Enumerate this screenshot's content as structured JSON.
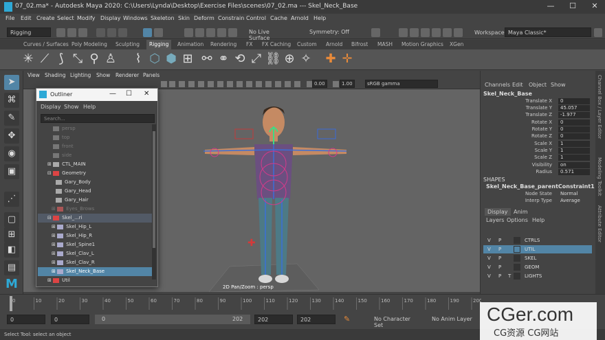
{
  "window": {
    "file_tab": "07_02.ma*",
    "title": "Autodesk Maya 2020: C:\\Users\\Lynda\\Desktop\\Exercise Files\\scenes\\07_02.ma  ---  Skel_Neck_Base",
    "minimize": "—",
    "maximize": "☐",
    "close": "✕"
  },
  "menubar": [
    "File",
    "Edit",
    "Create",
    "Select",
    "Modify",
    "Display",
    "Windows",
    "Skeleton",
    "Skin",
    "Deform",
    "Constrain",
    "Control",
    "Cache",
    "Arnold",
    "Help"
  ],
  "statusline": {
    "menuset": "Rigging",
    "live_surface": "No Live Surface",
    "symmetry": "Symmetry: Off",
    "workspace_label": "Workspace :",
    "workspace": "Maya Classic*"
  },
  "shelf_tabs": [
    "Curves / Surfaces",
    "Poly Modeling",
    "Sculpting",
    "Rigging",
    "Animation",
    "Rendering",
    "FX",
    "FX Caching",
    "Custom",
    "Arnold",
    "Bifrost",
    "MASH",
    "Motion Graphics",
    "XGen"
  ],
  "shelf_active": "Rigging",
  "viewport": {
    "menus": [
      "View",
      "Shading",
      "Lighting",
      "Show",
      "Renderer",
      "Panels"
    ],
    "exposure": "0.00",
    "gamma": "1.00",
    "colorspace": "sRGB gamma",
    "hud": "2D Pan/Zoom : persp"
  },
  "outliner": {
    "title": "Outliner",
    "menus": [
      "Display",
      "Show",
      "Help"
    ],
    "search_placeholder": "Search...",
    "rows": [
      {
        "label": "persp",
        "indent": 1,
        "dim": true
      },
      {
        "label": "top",
        "indent": 1,
        "dim": true
      },
      {
        "label": "front",
        "indent": 1,
        "dim": true
      },
      {
        "label": "side",
        "indent": 1,
        "dim": true
      },
      {
        "label": "CTL_MAIN",
        "indent": 1,
        "dim": false
      },
      {
        "label": "Geometry",
        "indent": 1,
        "dim": false
      },
      {
        "label": "Gary_Body",
        "indent": 2,
        "dim": false
      },
      {
        "label": "Gary_Head",
        "indent": 2,
        "dim": false
      },
      {
        "label": "Gary_Hair",
        "indent": 2,
        "dim": false
      },
      {
        "label": "Eyes_Brows",
        "indent": 2,
        "dim": true
      },
      {
        "label": "Skel_...ri",
        "indent": 1,
        "dim": false
      },
      {
        "label": "Skel_Hip_L",
        "indent": 2,
        "dim": false
      },
      {
        "label": "Skel_Hip_R",
        "indent": 2,
        "dim": false
      },
      {
        "label": "Skel_Spine1",
        "indent": 2,
        "dim": false
      },
      {
        "label": "Skel_Clav_L",
        "indent": 2,
        "dim": false
      },
      {
        "label": "Skel_Clav_R",
        "indent": 2,
        "dim": false
      },
      {
        "label": "Skel_Neck_Base",
        "indent": 2,
        "dim": false
      },
      {
        "label": "Util",
        "indent": 1,
        "dim": false
      }
    ]
  },
  "channelbox": {
    "menus": [
      "Channels",
      "Edit",
      "Object",
      "Show"
    ],
    "node": "Skel_Neck_Base",
    "channels": [
      {
        "name": "Translate X",
        "value": "0"
      },
      {
        "name": "Translate Y",
        "value": "45.057"
      },
      {
        "name": "Translate Z",
        "value": "-1.977"
      },
      {
        "name": "Rotate X",
        "value": "0"
      },
      {
        "name": "Rotate Y",
        "value": "0"
      },
      {
        "name": "Rotate Z",
        "value": "0"
      },
      {
        "name": "Scale X",
        "value": "1"
      },
      {
        "name": "Scale Y",
        "value": "1"
      },
      {
        "name": "Scale Z",
        "value": "1"
      },
      {
        "name": "Visibility",
        "value": "on"
      },
      {
        "name": "Radius",
        "value": "0.571"
      }
    ],
    "shapes_header": "SHAPES",
    "shape_node": "Skel_Neck_Base_parentConstraint1",
    "shape_attrs": [
      {
        "name": "Node State",
        "value": "Normal"
      },
      {
        "name": "Interp Type",
        "value": "Average"
      }
    ]
  },
  "layers": {
    "tabs": [
      "Display",
      "Anim"
    ],
    "menus": [
      "Layers",
      "Options",
      "Help"
    ],
    "rows": [
      {
        "v": "V",
        "p": "P",
        "t": "",
        "name": "CTRLS",
        "color": "#333",
        "sel": false
      },
      {
        "v": "V",
        "p": "P",
        "t": "",
        "name": "UTIL",
        "color": "#5285a6",
        "sel": true
      },
      {
        "v": "V",
        "p": "P",
        "t": "",
        "name": "SKEL",
        "color": "#333",
        "sel": false
      },
      {
        "v": "V",
        "p": "P",
        "t": "",
        "name": "GEOM",
        "color": "#333",
        "sel": false
      },
      {
        "v": "V",
        "p": "P",
        "t": "T",
        "name": "LIGHTS",
        "color": "#333",
        "sel": false
      }
    ]
  },
  "sidetabs": [
    "Channel Box / Layer Editor",
    "Modeling Toolkit",
    "Attribute Editor"
  ],
  "timeslider": {
    "ticks": [
      "0",
      "10",
      "20",
      "30",
      "40",
      "50",
      "60",
      "70",
      "80",
      "90",
      "100",
      "110",
      "120",
      "130",
      "140",
      "150",
      "160",
      "170",
      "180",
      "190",
      "200"
    ],
    "current": "0"
  },
  "range": {
    "start": "0",
    "playback_start": "0",
    "slider_start": "0",
    "slider_end": "202",
    "playback_end": "202",
    "end": "202",
    "character_set": "No Character Set",
    "anim_layer": "No Anim Layer"
  },
  "helpline": "Select Tool: select an object",
  "watermark": {
    "big": "CGer.com",
    "small": "CG资源 CG网站"
  },
  "colors": {
    "selection": "#5285a6",
    "accent": "#2ea9d6",
    "viewport_bg": "#646464"
  }
}
